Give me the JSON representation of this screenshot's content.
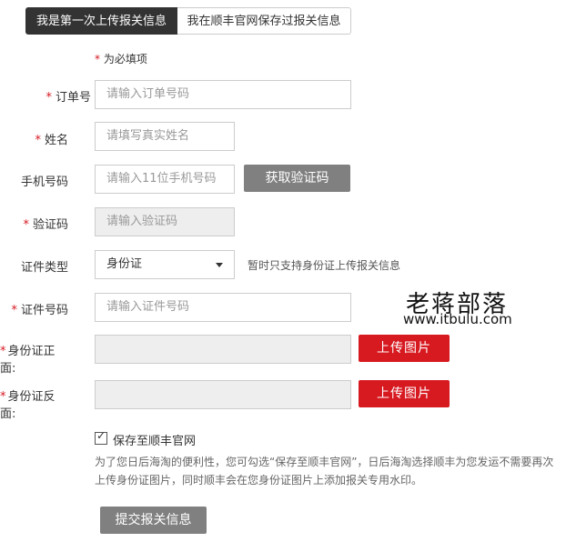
{
  "tabs": {
    "first_upload": "我是第一次上传报关信息",
    "saved_on_site": "我在顺丰官网保存过报关信息"
  },
  "required_note": {
    "star": "*",
    "text": " 为必填项"
  },
  "form": {
    "order_number": {
      "label": "订单号",
      "placeholder": "请输入订单号码",
      "required": true
    },
    "name": {
      "label": "姓名",
      "placeholder": "请填写真实姓名",
      "required": true
    },
    "phone": {
      "label": "手机号码",
      "placeholder": "请输入11位手机号码",
      "required": false
    },
    "get_code_button": "获取验证码",
    "verification_code": {
      "label": "验证码",
      "placeholder": "请输入验证码",
      "required": true
    },
    "id_type": {
      "label": "证件类型",
      "selected": "身份证",
      "required": false
    },
    "id_type_hint": "暂时只支持身份证上传报关信息",
    "id_number": {
      "label": "证件号码",
      "placeholder": "请输入证件号码",
      "required": true
    },
    "id_front": {
      "label": "身份证正面:",
      "required": true
    },
    "id_back": {
      "label": "身份证反面:",
      "required": true
    },
    "upload_button": "上传图片",
    "save_checkbox_label": "保存至顺丰官网",
    "save_checked": true,
    "description": "为了您日后海淘的便利性，您可勾选“保存至顺丰官网”，日后海淘选择顺丰为您发运不需要再次上传身份证图片，同时顺丰会在您身份证图片上添加报关专用水印。",
    "submit_button": "提交报关信息"
  },
  "watermark": {
    "cn": "老蒋部落",
    "en": "www.itbulu.com"
  },
  "colors": {
    "accent": "#d71920",
    "dark_tab": "#333333",
    "gray_button": "#808080"
  }
}
